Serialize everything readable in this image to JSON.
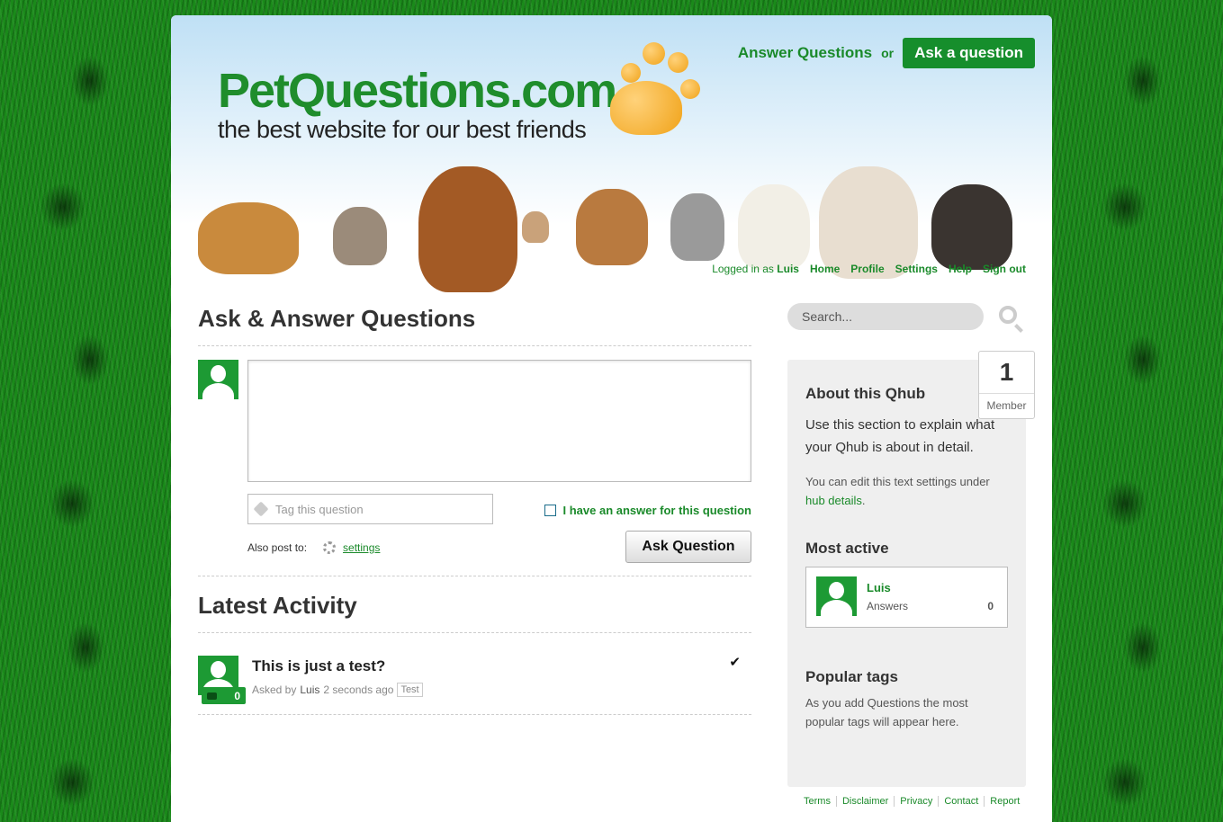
{
  "header": {
    "logo_title": "PetQuestions.com",
    "logo_subtitle": "the best website for our best friends",
    "answer_link": "Answer Questions",
    "or_text": "or",
    "ask_button": "Ask a question"
  },
  "usernav": {
    "logged_in_prefix": "Logged in as",
    "username": "Luis",
    "items": [
      "Home",
      "Profile",
      "Settings",
      "Help",
      "Sign out"
    ]
  },
  "main": {
    "title": "Ask & Answer Questions",
    "tag_placeholder": "Tag this question",
    "have_answer_label": "I have an answer for this question",
    "also_post_label": "Also post to:",
    "settings_link": "settings",
    "ask_question_button": "Ask Question"
  },
  "latest": {
    "title": "Latest Activity",
    "items": [
      {
        "title": "This is just a test?",
        "asked_by_prefix": "Asked by",
        "user": "Luis",
        "time": "2 seconds ago",
        "tag": "Test",
        "answers": "0"
      }
    ]
  },
  "sidebar": {
    "search_placeholder": "Search...",
    "member_count": "1",
    "member_label": "Member",
    "about_title": "About this Qhub",
    "about_text": "Use this section to explain what your Qhub is about in detail.",
    "edit_text_prefix": "You can edit this text settings under",
    "edit_link": "hub details",
    "edit_suffix": ".",
    "most_active_title": "Most active",
    "most_active_user": "Luis",
    "most_active_label": "Answers",
    "most_active_count": "0",
    "popular_title": "Popular tags",
    "popular_text": "As you add Questions the most popular tags will appear here."
  },
  "footer": {
    "links": [
      "Terms",
      "Disclaimer",
      "Privacy",
      "Contact",
      "Report"
    ]
  },
  "colors": {
    "brand_green": "#1a8a2a",
    "button_green": "#168e2c",
    "paw_orange": "#f0a218"
  }
}
